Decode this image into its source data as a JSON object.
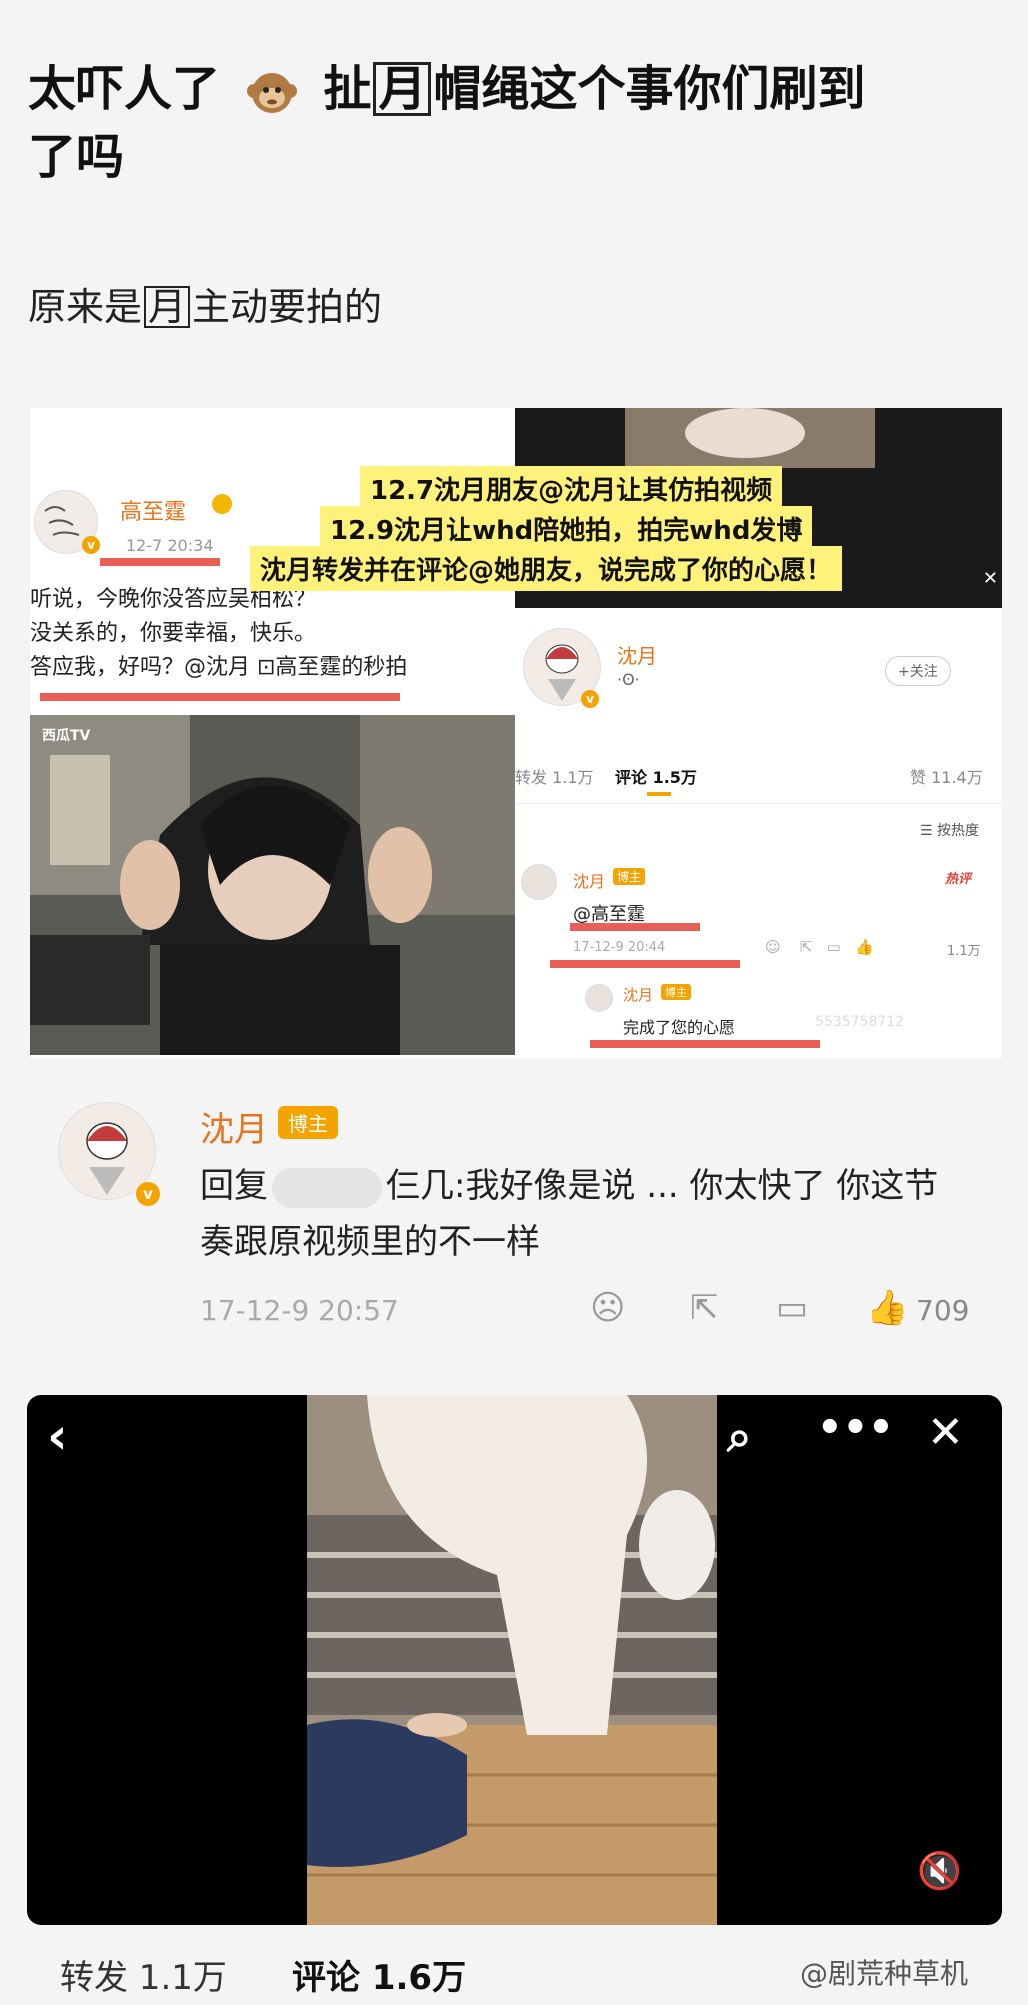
{
  "post": {
    "title_part1": "太吓人了",
    "title_part2": "扯",
    "title_box": "月",
    "title_part3": "帽绳这个事你们刷到",
    "title_line2": "了吗",
    "subtitle_part1": "原来是",
    "subtitle_box": "月",
    "subtitle_part2": "主动要拍的"
  },
  "left_post": {
    "username": "高至霆",
    "time": "12-7 20:34",
    "line1": "听说，今晚你没答应吴柏松？",
    "line2": "没关系的，你要幸福，快乐。",
    "line3": "答应我，好吗？@沈月 ⊡高至霆的秒拍",
    "video_logo": "西瓜TV"
  },
  "banner": {
    "line1": "12.7沈月朋友@沈月让其仿拍视频",
    "line2": "12.9沈月让whd陪她拍，拍完whd发博",
    "line3": "沈月转发并在评论@她朋友，说完成了你的心愿！"
  },
  "right_post": {
    "username": "沈月",
    "sub": "·ʘ·",
    "follow": "+关注",
    "tab_repost": "转发 1.1万",
    "tab_comment": "评论 1.5万",
    "tab_like": "赞 11.4万",
    "sort": "按热度",
    "c1_user": "沈月",
    "c1_badge": "博主",
    "c1_hot": "热评",
    "c1_text": "@高至霆",
    "c1_time": "17-12-9 20:44",
    "c1_likes": "1.1万",
    "c2_user": "沈月",
    "c2_badge": "博主",
    "c2_text": "完成了您的心愿",
    "c2_watermark": "5535758712"
  },
  "comment": {
    "username": "沈月",
    "badge": "博主",
    "text_prefix": "回复",
    "text_suffix": "仨几:我好像是说 ... 你太快了 你这节",
    "text_line2": "奏跟原视频里的不一样",
    "time": "17-12-9 20:57",
    "likes": "709"
  },
  "bottom": {
    "repost": "转发 1.1万",
    "comment": "评论 1.6万",
    "watermark": "@剧荒种草机"
  }
}
